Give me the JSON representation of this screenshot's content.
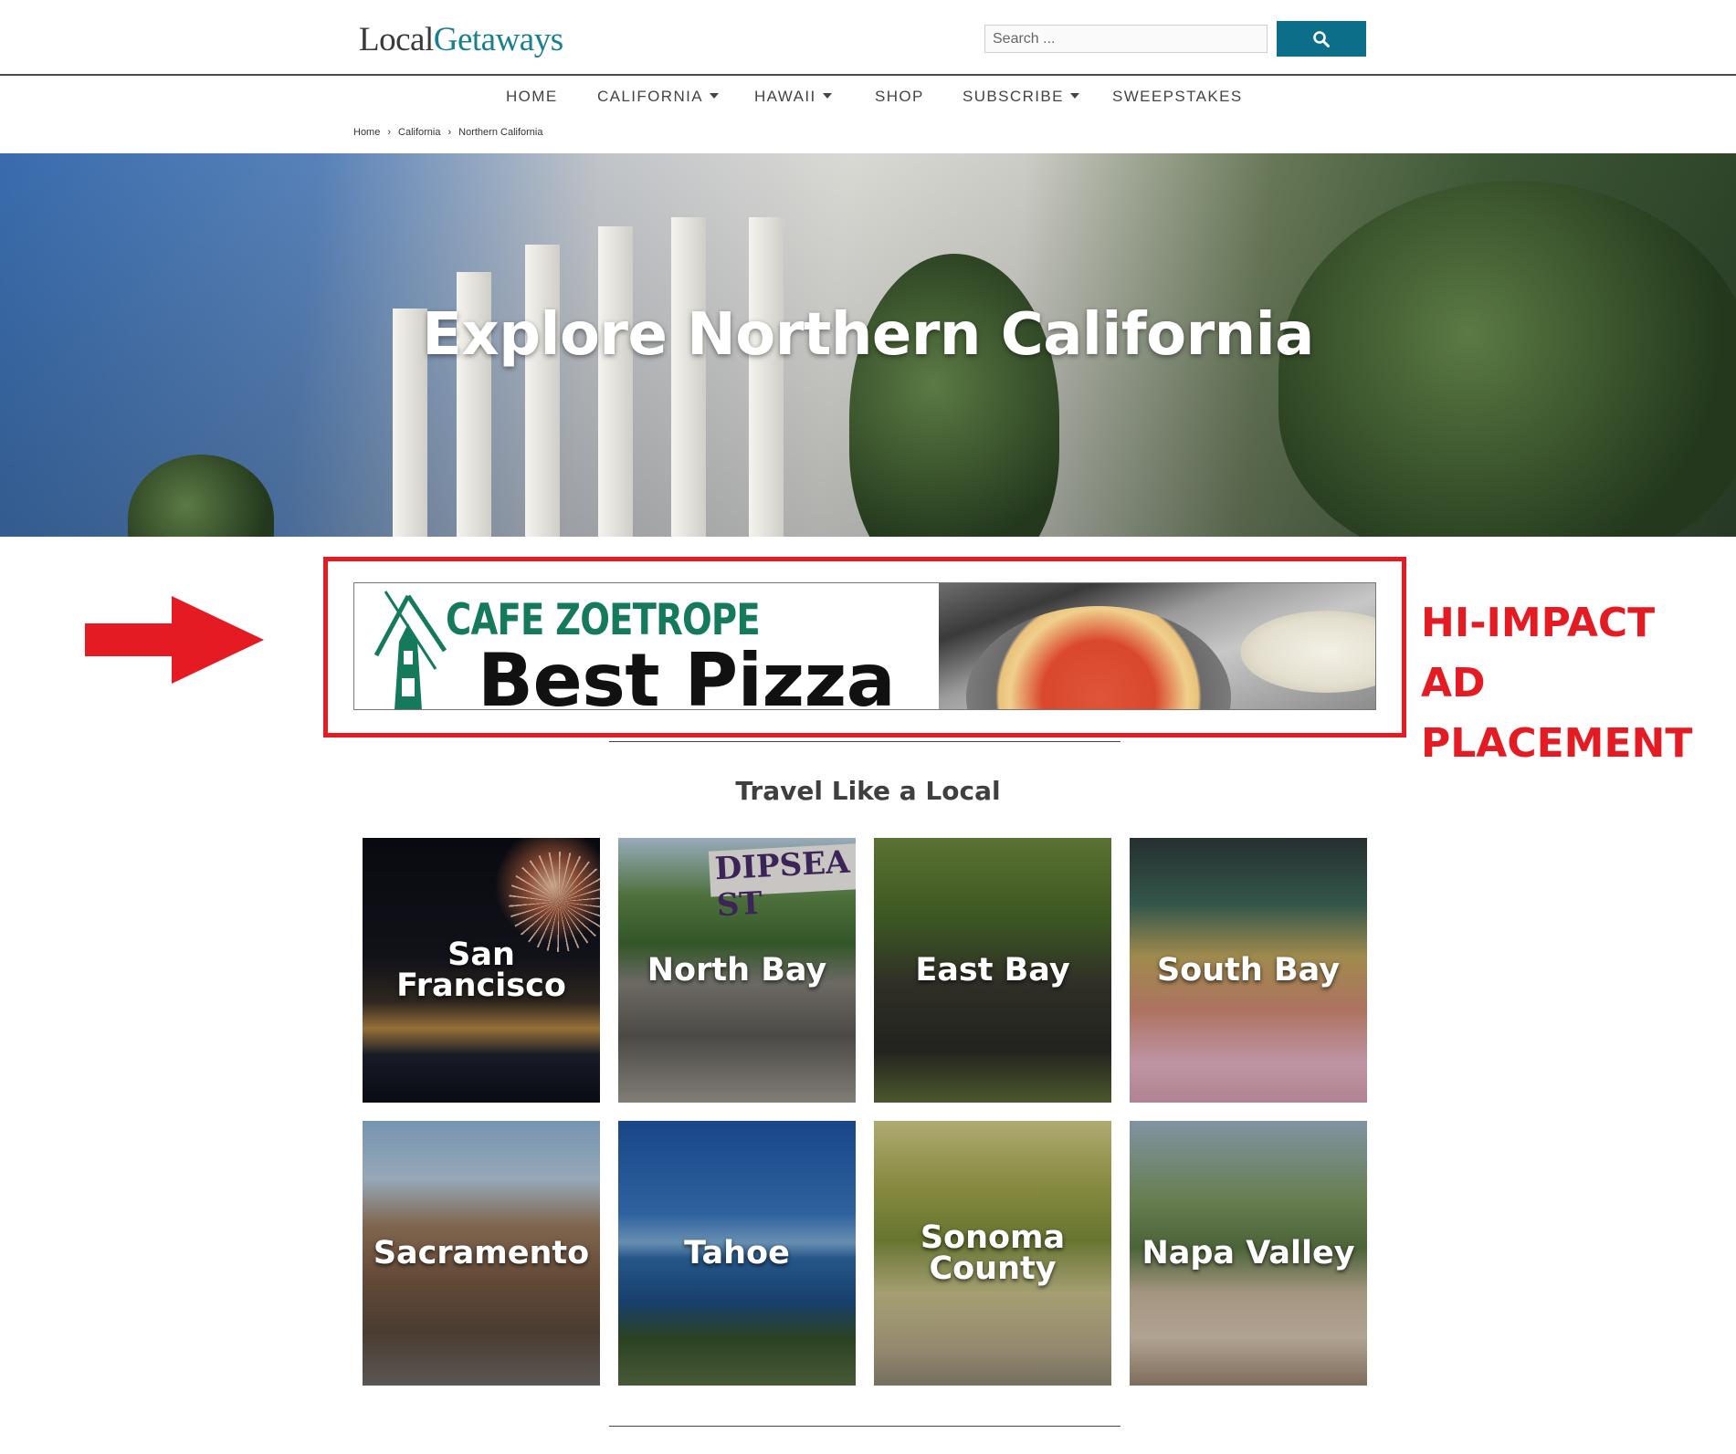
{
  "header": {
    "logo_primary": "Local",
    "logo_accent": "Getaways",
    "search_placeholder": "Search ..."
  },
  "nav": {
    "items": [
      {
        "label": "HOME",
        "dropdown": false
      },
      {
        "label": "CALIFORNIA",
        "dropdown": true
      },
      {
        "label": "HAWAII",
        "dropdown": true
      },
      {
        "label": "SHOP",
        "dropdown": false
      },
      {
        "label": "SUBSCRIBE",
        "dropdown": true
      },
      {
        "label": "SWEEPSTAKES",
        "dropdown": false
      }
    ]
  },
  "breadcrumb": [
    "Home",
    "California",
    "Northern California"
  ],
  "hero": {
    "title": "Explore Northern California"
  },
  "ad": {
    "brand": "CAFE ZOETROPE",
    "headline": "Best Pizza",
    "callout_line1": "HI-IMPACT AD",
    "callout_line2": "PLACEMENT"
  },
  "section": {
    "title": "Travel Like a Local"
  },
  "tiles": [
    {
      "label": "San Francisco"
    },
    {
      "label": "North Bay"
    },
    {
      "label": "East Bay"
    },
    {
      "label": "South Bay"
    },
    {
      "label": "Sacramento"
    },
    {
      "label": "Tahoe"
    },
    {
      "label": "Sonoma County"
    },
    {
      "label": "Napa Valley"
    }
  ],
  "tile_photo_text": {
    "north_bay_sign": "DIPSEA ST"
  },
  "colors": {
    "brand_teal": "#1a7f8e",
    "search_button": "#0d6e8a",
    "ad_highlight": "#e51b23",
    "ad_brand_green": "#157a5c"
  },
  "icons": {
    "search_button": "search-icon",
    "ad_pointer": "arrow-right-icon",
    "nav_dropdown": "caret-down-icon",
    "breadcrumb_separator": "chevron-right-icon"
  }
}
